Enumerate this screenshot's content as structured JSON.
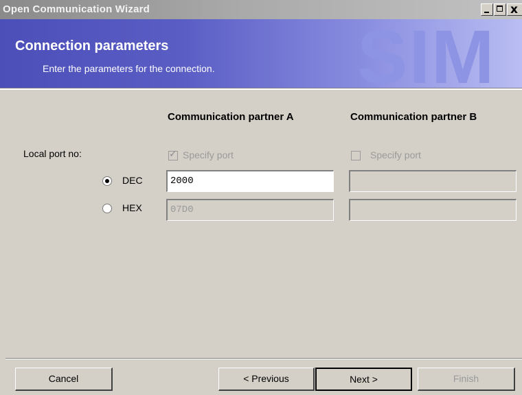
{
  "window": {
    "title": "Open Communication Wizard",
    "close_glyph": "x"
  },
  "header": {
    "title": "Connection parameters",
    "subtitle": "Enter the parameters for the connection.",
    "watermark": "SIM"
  },
  "columns": {
    "a": "Communication partner A",
    "b": "Communication partner B"
  },
  "local_port": {
    "label": "Local port no:",
    "partner_a": {
      "specify_port_label": "Specify port",
      "specify_port_checked": true,
      "dec_value": "2000",
      "hex_value": "07D0"
    },
    "partner_b": {
      "specify_port_label": "Specify port",
      "specify_port_checked": false,
      "dec_value": "",
      "hex_value": ""
    },
    "format": {
      "dec_label": "DEC",
      "hex_label": "HEX",
      "selected": "DEC"
    }
  },
  "buttons": {
    "cancel": "Cancel",
    "previous": "< Previous",
    "next": "Next >",
    "finish": "Finish"
  },
  "colors": {
    "dialog_bg": "#d4d0c8",
    "banner_start": "#4c4fb8",
    "banner_end": "#b9bdf2",
    "disabled_text": "#9a9a9a"
  }
}
